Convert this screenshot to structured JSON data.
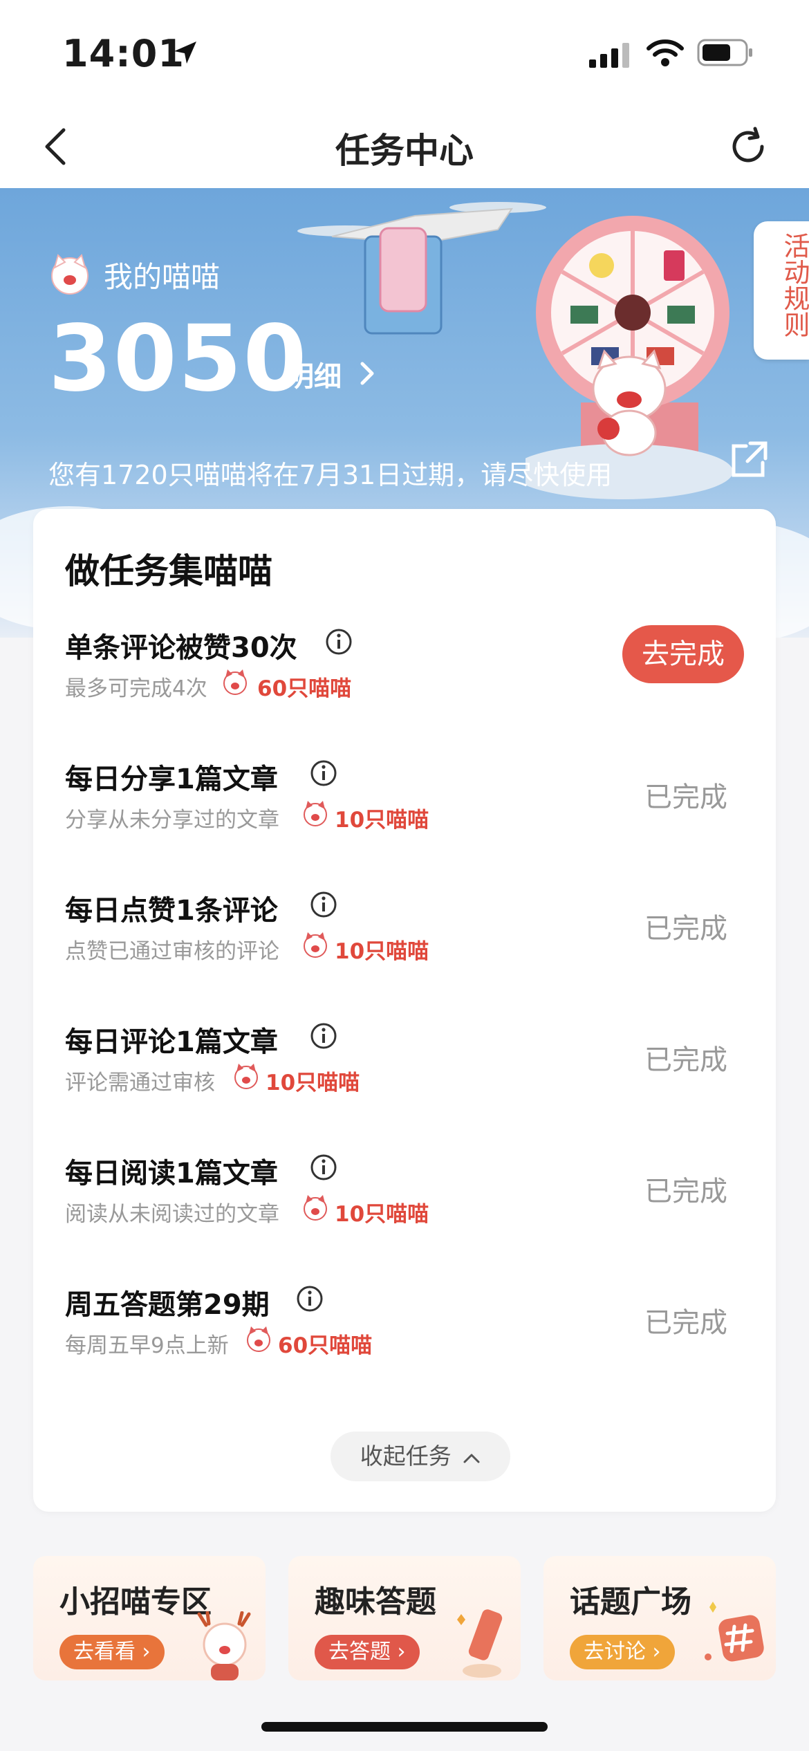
{
  "status_bar": {
    "time": "14:01"
  },
  "nav": {
    "title": "任务中心"
  },
  "hero": {
    "my_label": "我的喵喵",
    "points": "3050",
    "detail_label": "明细",
    "expire_notice": "您有1720只喵喵将在7月31日过期，请尽快使用",
    "rules_label": "活动规则"
  },
  "tasks_section": {
    "title": "做任务集喵喵",
    "items": [
      {
        "name": "单条评论被赞30次",
        "desc": "最多可完成4次",
        "reward": "60只喵喵",
        "action": "去完成",
        "status": "pending"
      },
      {
        "name": "每日分享1篇文章",
        "desc": "分享从未分享过的文章",
        "reward": "10只喵喵",
        "action": "已完成",
        "status": "done"
      },
      {
        "name": "每日点赞1条评论",
        "desc": "点赞已通过审核的评论",
        "reward": "10只喵喵",
        "action": "已完成",
        "status": "done"
      },
      {
        "name": "每日评论1篇文章",
        "desc": "评论需通过审核",
        "reward": "10只喵喵",
        "action": "已完成",
        "status": "done"
      },
      {
        "name": "每日阅读1篇文章",
        "desc": "阅读从未阅读过的文章",
        "reward": "10只喵喵",
        "action": "已完成",
        "status": "done"
      },
      {
        "name": "周五答题第29期",
        "desc": "每周五早9点上新",
        "reward": "60只喵喵",
        "action": "已完成",
        "status": "done"
      }
    ],
    "collapse_label": "收起任务"
  },
  "features": [
    {
      "title": "小招喵专区",
      "button": "去看看",
      "button_color": "#e8743b"
    },
    {
      "title": "趣味答题",
      "button": "去答题",
      "button_color": "#e0584a"
    },
    {
      "title": "话题广场",
      "button": "去讨论",
      "button_color": "#f0a53a"
    }
  ],
  "colors": {
    "accent": "#e5584a",
    "reward": "#e0483b",
    "hero_blue": "#6ea6db"
  }
}
